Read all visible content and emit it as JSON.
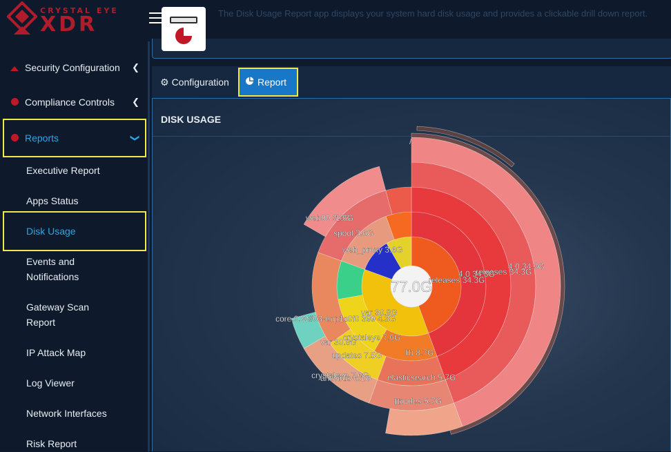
{
  "brand": {
    "top": "CRYSTAL EYE",
    "main": "XDR"
  },
  "app": {
    "description": "The Disk Usage Report app displays your system hard disk usage and provides a clickable drill down report."
  },
  "sidebar": {
    "items": [
      {
        "label": "Security Configuration",
        "icon": "triangle-icon"
      },
      {
        "label": "Compliance Controls",
        "icon": "circle-icon"
      },
      {
        "label": "Reports",
        "icon": "circle-icon"
      }
    ],
    "reports_sub": [
      "Executive Report",
      "Apps Status",
      "Disk Usage",
      "Events and",
      "Notifications",
      "Gateway Scan",
      "Report",
      "IP Attack Map",
      "Log Viewer",
      "Network Interfaces",
      "Risk Report"
    ]
  },
  "tabs": [
    {
      "label": "Configuration",
      "icon": "gear-icon"
    },
    {
      "label": "Report",
      "icon": "pie-chart-icon"
    }
  ],
  "panel": {
    "title": "DISK USAGE"
  },
  "chart_data": {
    "type": "sunburst",
    "center_label": "77.0G",
    "root_label": "/",
    "labels": [
      "4.0 34.3G",
      "releases 34.3G",
      "releases 34.3G",
      "4.0 34.3G",
      "web00 3.6G",
      "1.6G",
      "spool 3.6G",
      "web_proxy 3.6G",
      "var 30.8G",
      "core.0.W#03-enp1s0f0 399 4.3G",
      "var 30.8G",
      "crystaleye 7.6G",
      "updates 7.5G",
      "lib 8.7G",
      "crystaleye 7.6G",
      "antivirus 6.1G",
      "elasticsearch 5.7G",
      "nodes 5.7G",
      "lib"
    ],
    "colors": {
      "releases": "#e3353b",
      "var": "#f2c10c",
      "lib": "#f27b27",
      "small": "#e89a7f"
    }
  }
}
